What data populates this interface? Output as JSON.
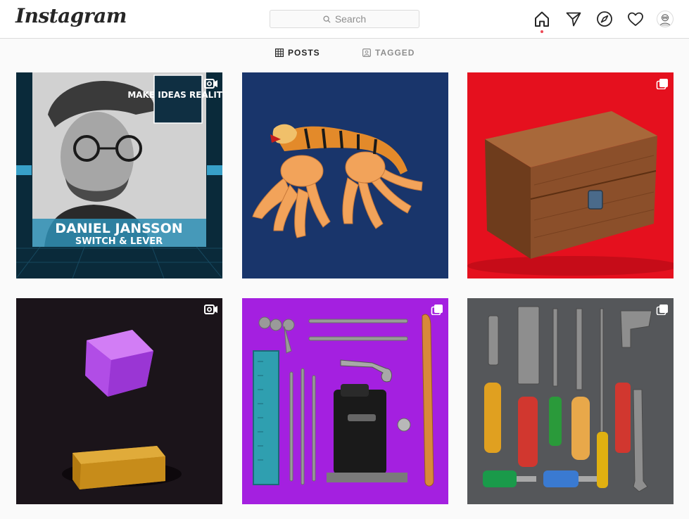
{
  "app": {
    "logo": "Instagram"
  },
  "search": {
    "placeholder": "Search"
  },
  "nav": {
    "icons": [
      "home-icon",
      "direct-icon",
      "explore-icon",
      "activity-heart-icon",
      "profile-avatar"
    ],
    "active": "home-icon",
    "notification_color": "#ed4956"
  },
  "tabs": [
    {
      "label": "POSTS",
      "icon": "grid-icon",
      "active": true
    },
    {
      "label": "TAGGED",
      "icon": "tagged-icon",
      "active": false
    }
  ],
  "posts": [
    {
      "type": "igtv",
      "colors": [
        "#0a2a3a",
        "#38a0c8"
      ],
      "poster": {
        "title": "MAKE IDEAS REALITY",
        "name": "DANIEL JANSSON",
        "subtitle": "SWITCH & LEVER"
      }
    },
    {
      "type": "image",
      "colors": [
        "#1d3a72",
        "#f2a35a"
      ]
    },
    {
      "type": "carousel",
      "colors": [
        "#e5101e",
        "#8b4f2a"
      ]
    },
    {
      "type": "igtv",
      "colors": [
        "#1b141a",
        "#b14de6"
      ]
    },
    {
      "type": "carousel",
      "colors": [
        "#a420e0",
        "#2f9fb0"
      ]
    },
    {
      "type": "carousel",
      "colors": [
        "#55575a",
        "#d1372f"
      ]
    }
  ]
}
